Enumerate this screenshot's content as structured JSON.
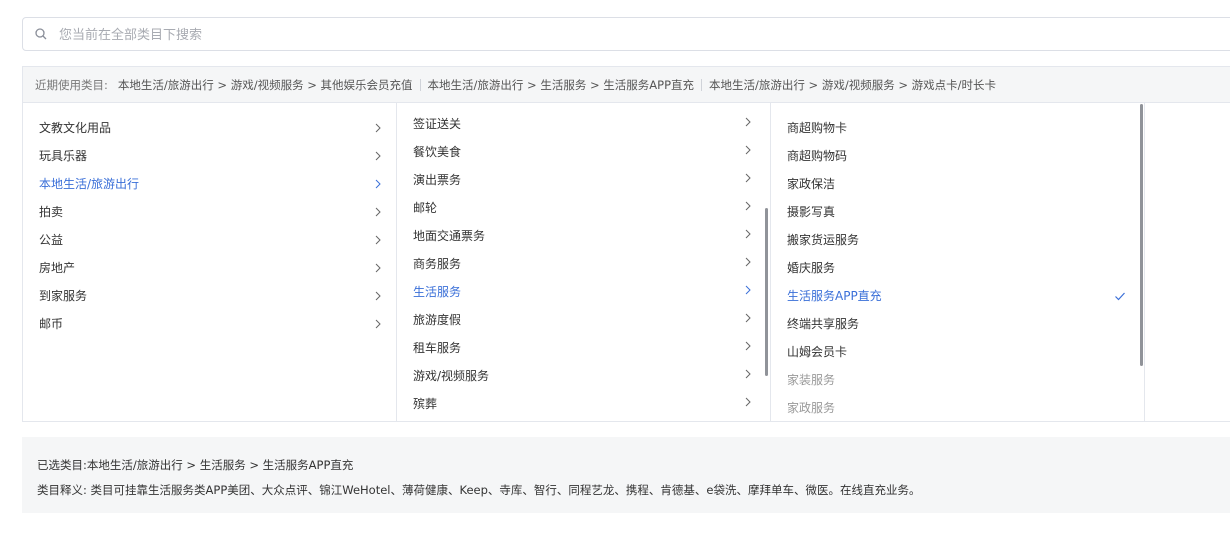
{
  "search": {
    "placeholder": "您当前在全部类目下搜索"
  },
  "recent": {
    "label": "近期使用类目:",
    "items": [
      "本地生活/旅游出行 > 游戏/视频服务 > 其他娱乐会员充值",
      "本地生活/旅游出行 > 生活服务 > 生活服务APP直充",
      "本地生活/旅游出行 > 游戏/视频服务 > 游戏点卡/时长卡"
    ]
  },
  "col1": {
    "items": [
      {
        "label": "文教文化用品"
      },
      {
        "label": "玩具乐器"
      },
      {
        "label": "本地生活/旅游出行"
      },
      {
        "label": "拍卖"
      },
      {
        "label": "公益"
      },
      {
        "label": "房地产"
      },
      {
        "label": "到家服务"
      },
      {
        "label": "邮币"
      }
    ]
  },
  "col2": {
    "items": [
      {
        "label": "签证送关"
      },
      {
        "label": "餐饮美食"
      },
      {
        "label": "演出票务"
      },
      {
        "label": "邮轮"
      },
      {
        "label": "地面交通票务"
      },
      {
        "label": "商务服务"
      },
      {
        "label": "生活服务"
      },
      {
        "label": "旅游度假"
      },
      {
        "label": "租车服务"
      },
      {
        "label": "游戏/视频服务"
      },
      {
        "label": "殡葬"
      }
    ]
  },
  "col3": {
    "items": [
      {
        "label": "商超购物卡"
      },
      {
        "label": "商超购物码"
      },
      {
        "label": "家政保洁"
      },
      {
        "label": "摄影写真"
      },
      {
        "label": "搬家货运服务"
      },
      {
        "label": "婚庆服务"
      },
      {
        "label": "生活服务APP直充"
      },
      {
        "label": "终端共享服务"
      },
      {
        "label": "山姆会员卡"
      },
      {
        "label": "家装服务"
      },
      {
        "label": "家政服务"
      }
    ]
  },
  "footer": {
    "selected_label": "已选类目:",
    "selected_value": "本地生活/旅游出行 > 生活服务 > 生活服务APP直充",
    "desc_label": "类目释义:",
    "desc_value": "类目可挂靠生活服务类APP美团、大众点评、锦江WeHotel、薄荷健康、Keep、寺库、智行、同程艺龙、携程、肯德基、e袋洗、摩拜单车、微医。在线直充业务。"
  },
  "colors": {
    "accent": "#3a6fd8",
    "border": "#e4e7ed",
    "muted": "#999999"
  }
}
